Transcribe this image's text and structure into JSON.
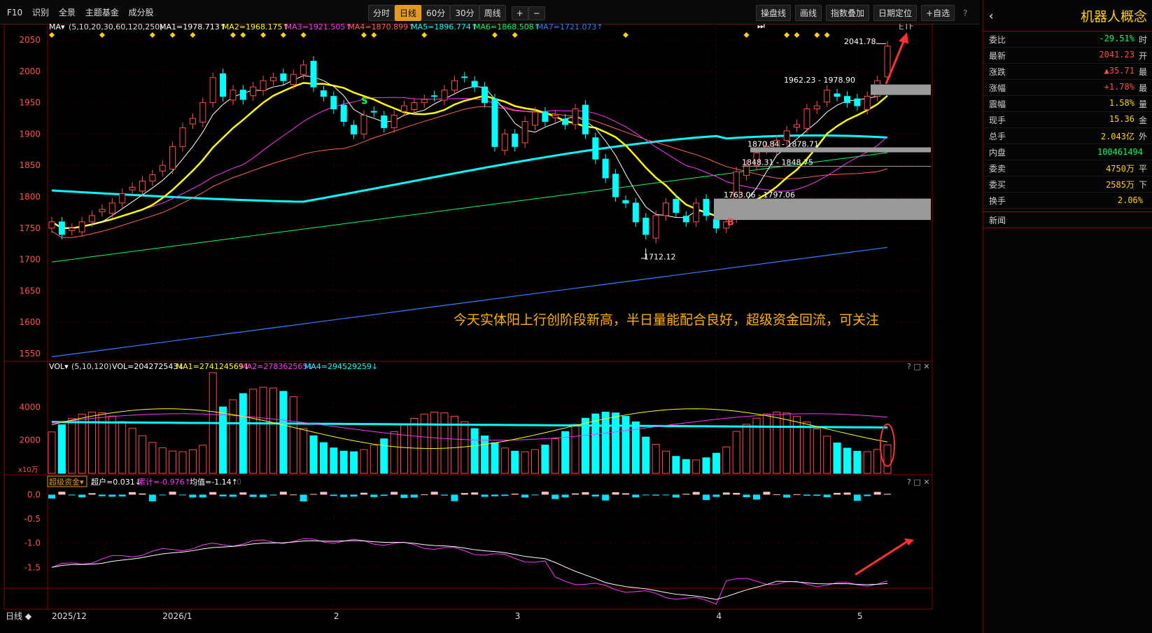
{
  "toolbar": {
    "left_items": [
      "F10",
      "识别",
      "全景",
      "主题基金",
      "成分股"
    ],
    "periods": [
      "分时",
      "日线",
      "60分",
      "30分",
      "周线"
    ],
    "active_period": "日线",
    "right_items": [
      "操盘线",
      "画线",
      "指数叠加",
      "日期定位",
      "+自选"
    ],
    "etf_label": "ETF",
    "help_icon": "?",
    "collapse_icon": "⏭"
  },
  "main_chart": {
    "legend_prefix": "MA▾",
    "legend_params": "(5,10,20,30,60,120,250)",
    "legend": [
      {
        "label": "MA1=1978.713↑",
        "color": "#ffffff"
      },
      {
        "label": "MA2=1968.175↑",
        "color": "#ffff00"
      },
      {
        "label": "MA3=1921.505↑",
        "color": "#ff33ff"
      },
      {
        "label": "MA4=1870.899↑",
        "color": "#ff6060"
      },
      {
        "label": "MA5=1896.774↑",
        "color": "#00ffff"
      },
      {
        "label": "MA6=1868.508↑",
        "color": "#00ff66"
      },
      {
        "label": "MA7=1721.073↑",
        "color": "#2f7fff"
      }
    ],
    "y_ticks": [
      "2050",
      "2000",
      "1950",
      "1900",
      "1850",
      "1800",
      "1750",
      "1700",
      "1650",
      "1600",
      "1550"
    ],
    "annotations": {
      "high_label": "2041.78",
      "low_label": "1712.12",
      "range1": "1962.23 - 1978.90",
      "range2": "1870.84 - 1878.71",
      "range3": "1848.31 - 1848.75",
      "range4": "1763.06 - 1797.06",
      "marker_s": "S",
      "marker_b": "B",
      "comment": "今天实体阳上行创阶段新高，半日量能配合良好，超级资金回流，可关注"
    },
    "colors": {
      "up": "#ff4a4a",
      "down": "#00ffff",
      "ma_white": "#ffffff",
      "ma_yellow": "#ffff00",
      "ma_magenta": "#ff33ff",
      "ma_red": "#ff6060",
      "ma_cyan": "#00ffff",
      "ma_green": "#00ff66",
      "ma_blue": "#2f7fff"
    }
  },
  "volume_chart": {
    "legend_prefix": "VOL▾",
    "legend_params": "(5,10,120)",
    "legend": [
      {
        "label": "VOL=204272543↓",
        "color": "#ffffff"
      },
      {
        "label": "MA1=274124569↓",
        "color": "#ffff00"
      },
      {
        "label": "MA2=278362565↓",
        "color": "#ff33ff"
      },
      {
        "label": "MA4=294529259↓",
        "color": "#00ffff"
      }
    ],
    "y_ticks": [
      "4000",
      "2000"
    ],
    "unit_label": "x10万",
    "panel_icons": "? □ ✕"
  },
  "fund_chart": {
    "title": "超级资金▾",
    "legend": [
      {
        "label": "超户=0.031↓",
        "color": "#ffffff"
      },
      {
        "label": "累计=-0.976↑",
        "color": "#ff33ff"
      },
      {
        "label": "均值=-1.14↑",
        "color": "#ffffff"
      },
      {
        "label": "0",
        "color": "#555555"
      }
    ],
    "y_ticks": [
      "0.0",
      "-0.5",
      "-1.0",
      "-1.5"
    ],
    "panel_icons": "? □ ✕"
  },
  "x_axis": {
    "period_label": "日线 ◆",
    "labels": [
      "2025/12",
      "2026/1",
      "2",
      "3",
      "4",
      "5"
    ]
  },
  "side_panel": {
    "title": "机器人概念",
    "back_icon": "‹",
    "rows": [
      {
        "k": "委比",
        "v": "-29.51%",
        "c": "#00ff66",
        "extra": "时"
      },
      {
        "k": "最新",
        "v": "2041.23",
        "c": "#ff4a4a",
        "extra": "开"
      },
      {
        "k": "涨跌",
        "v": "▲35.71",
        "c": "#ff4a4a",
        "extra": "最"
      },
      {
        "k": "涨幅",
        "v": "+1.78%",
        "c": "#ff4a4a",
        "extra": "最"
      },
      {
        "k": "震幅",
        "v": "1.58%",
        "c": "#ffd200",
        "extra": "量"
      },
      {
        "k": "现手",
        "v": "15.36",
        "c": "#ffd200",
        "extra": "金"
      },
      {
        "k": "总手",
        "v": "2.043亿",
        "c": "#ffd200",
        "extra": "外"
      },
      {
        "k": "内盘",
        "v": "100461494",
        "c": "#00ff66",
        "extra": ""
      },
      {
        "k": "委卖",
        "v": "4750万",
        "c": "#ffd200",
        "extra": "平"
      },
      {
        "k": "委买",
        "v": "2585万",
        "c": "#ffd200",
        "extra": "下"
      },
      {
        "k": "换手",
        "v": "2.06%",
        "c": "#ffd200",
        "extra": ""
      }
    ],
    "news_label": "新闻"
  },
  "chart_data": {
    "type": "candlestick",
    "y_range_price": [
      1540,
      2060
    ],
    "closes_approx": [
      1760,
      1740,
      1750,
      1760,
      1770,
      1780,
      1790,
      1805,
      1815,
      1825,
      1835,
      1850,
      1880,
      1910,
      1925,
      1950,
      1990,
      1960,
      1970,
      1955,
      1975,
      1985,
      1990,
      1985,
      1995,
      2010,
      1975,
      1960,
      1940,
      1920,
      1900,
      1930,
      1935,
      1910,
      1930,
      1945,
      1950,
      1955,
      1960,
      1970,
      1985,
      1990,
      1975,
      1950,
      1880,
      1900,
      1880,
      1920,
      1935,
      1920,
      1930,
      1915,
      1940,
      1900,
      1860,
      1830,
      1800,
      1790,
      1760,
      1740,
      1770,
      1790,
      1775,
      1760,
      1790,
      1770,
      1750,
      1760,
      1840,
      1850,
      1870,
      1880,
      1890,
      1905,
      1915,
      1940,
      1945,
      1970,
      1960,
      1950,
      1945,
      1960,
      1985,
      2040
    ],
    "volume_y_range": [
      0,
      6000
    ],
    "fund_y_range": [
      -1.9,
      0.15
    ]
  }
}
